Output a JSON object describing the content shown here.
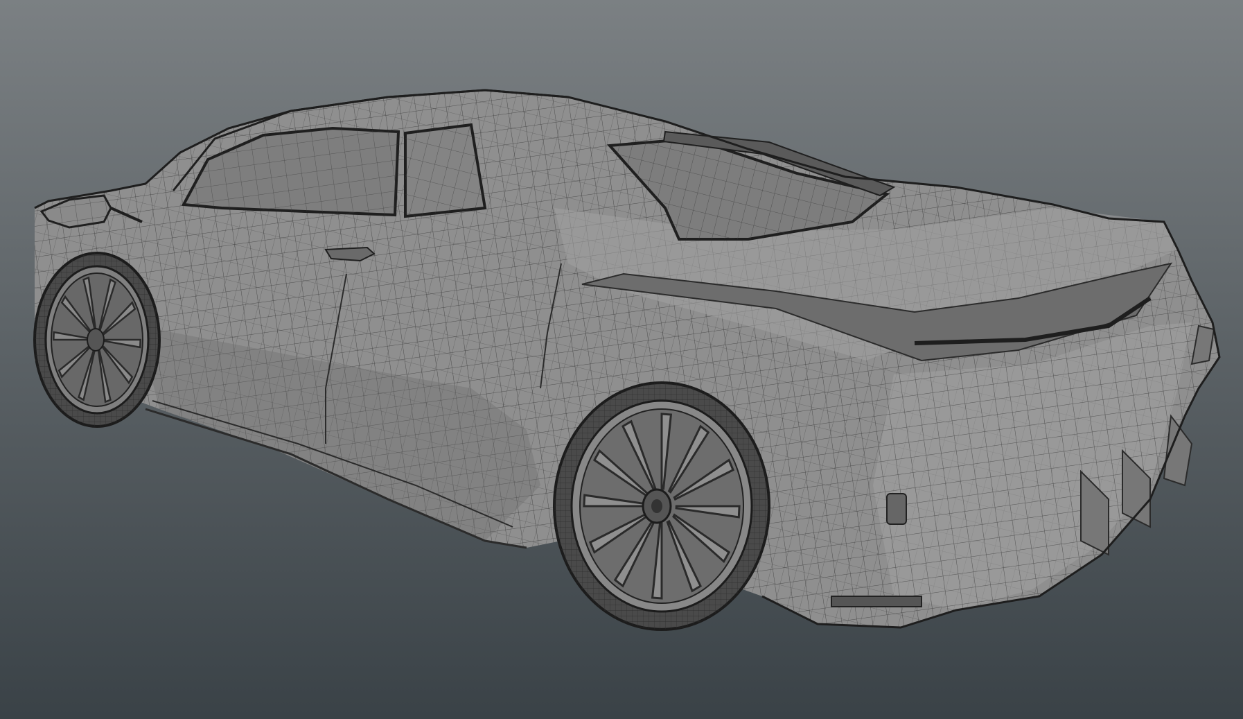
{
  "scene": {
    "subject": "car-wireframe-mesh",
    "view": "rear-three-quarter",
    "shading": "clay-with-wireframe"
  },
  "colors": {
    "background_top": "#7b8083",
    "background_bottom": "#3a4247",
    "body": "#8f8f8f",
    "body_light": "#a3a3a3",
    "body_dark": "#6a6a6a",
    "wire": "#3c3c3c",
    "wire_dense": "#2b2b2b"
  }
}
